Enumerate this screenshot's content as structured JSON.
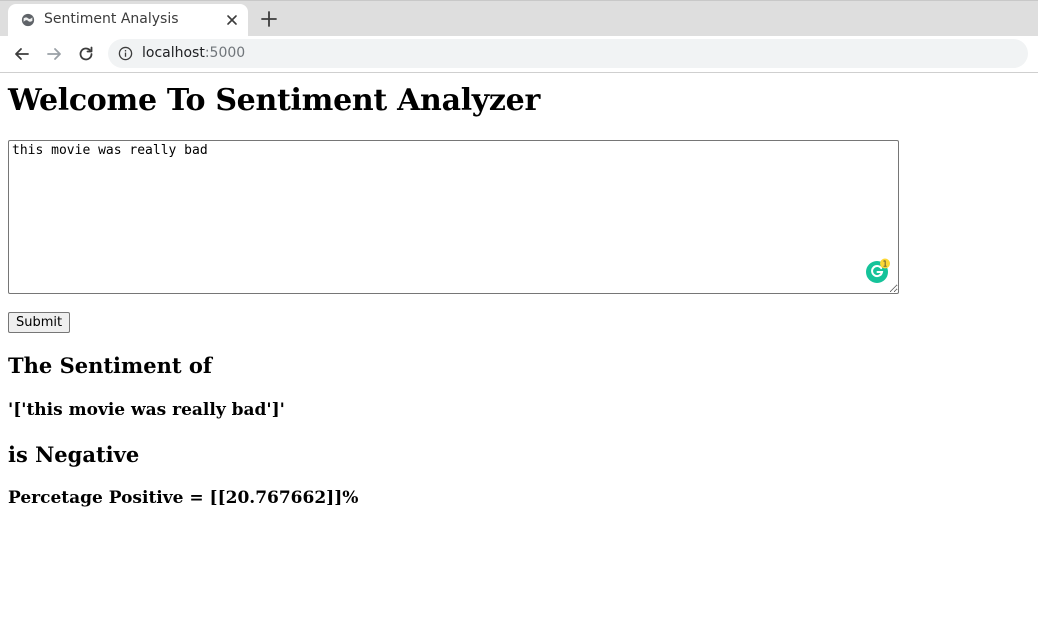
{
  "browser": {
    "tab_title": "Sentiment Analysis",
    "url_host": "localhost",
    "url_port": ":5000",
    "icons": {
      "favicon": "globe-icon",
      "close": "close-icon",
      "new_tab": "plus-icon",
      "back": "arrow-left-icon",
      "forward": "arrow-right-icon",
      "reload": "reload-icon",
      "site_info": "info-icon"
    }
  },
  "page": {
    "title": "Welcome To Sentiment Analyzer",
    "textarea_value": "this movie was really bad",
    "submit_label": "Submit",
    "grammarly_badge_count": "1",
    "result_heading": "The Sentiment of",
    "result_text": "'['this movie was really bad']'",
    "result_label": "is Negative",
    "result_percent": "Percetage Positive = [[20.767662]]%"
  },
  "colors": {
    "grammarly_green": "#15c39a",
    "grammarly_badge": "#fdd835"
  }
}
